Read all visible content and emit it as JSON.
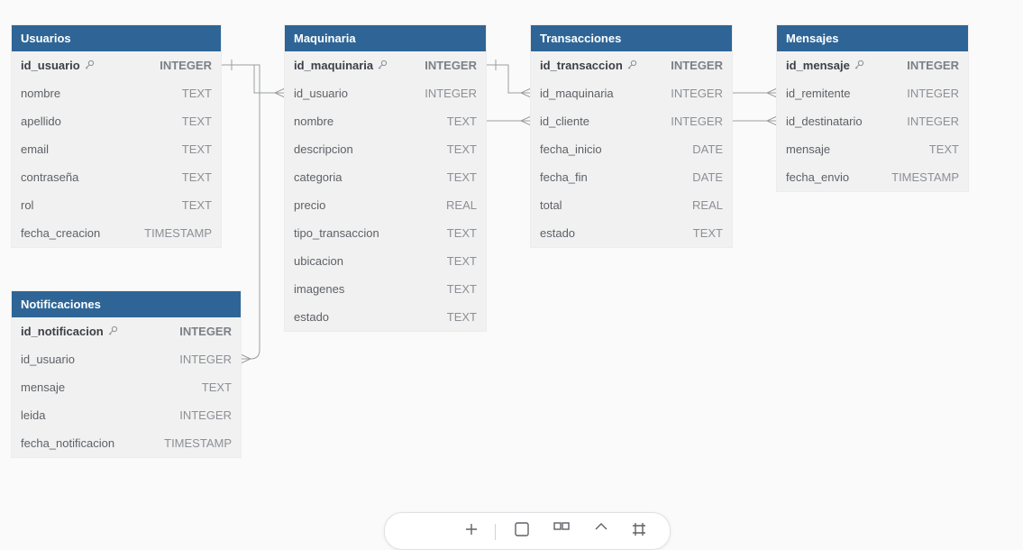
{
  "tables": {
    "usuarios": {
      "title": "Usuarios",
      "columns": [
        {
          "name": "id_usuario",
          "type": "INTEGER"
        },
        {
          "name": "nombre",
          "type": "TEXT"
        },
        {
          "name": "apellido",
          "type": "TEXT"
        },
        {
          "name": "email",
          "type": "TEXT"
        },
        {
          "name": "contraseña",
          "type": "TEXT"
        },
        {
          "name": "rol",
          "type": "TEXT"
        },
        {
          "name": "fecha_creacion",
          "type": "TIMESTAMP"
        }
      ]
    },
    "maquinaria": {
      "title": "Maquinaria",
      "columns": [
        {
          "name": "id_maquinaria",
          "type": "INTEGER"
        },
        {
          "name": "id_usuario",
          "type": "INTEGER"
        },
        {
          "name": "nombre",
          "type": "TEXT"
        },
        {
          "name": "descripcion",
          "type": "TEXT"
        },
        {
          "name": "categoria",
          "type": "TEXT"
        },
        {
          "name": "precio",
          "type": "REAL"
        },
        {
          "name": "tipo_transaccion",
          "type": "TEXT"
        },
        {
          "name": "ubicacion",
          "type": "TEXT"
        },
        {
          "name": "imagenes",
          "type": "TEXT"
        },
        {
          "name": "estado",
          "type": "TEXT"
        }
      ]
    },
    "transacciones": {
      "title": "Transacciones",
      "columns": [
        {
          "name": "id_transaccion",
          "type": "INTEGER"
        },
        {
          "name": "id_maquinaria",
          "type": "INTEGER"
        },
        {
          "name": "id_cliente",
          "type": "INTEGER"
        },
        {
          "name": "fecha_inicio",
          "type": "DATE"
        },
        {
          "name": "fecha_fin",
          "type": "DATE"
        },
        {
          "name": "total",
          "type": "REAL"
        },
        {
          "name": "estado",
          "type": "TEXT"
        }
      ]
    },
    "mensajes": {
      "title": "Mensajes",
      "columns": [
        {
          "name": "id_mensaje",
          "type": "INTEGER"
        },
        {
          "name": "id_remitente",
          "type": "INTEGER"
        },
        {
          "name": "id_destinatario",
          "type": "INTEGER"
        },
        {
          "name": "mensaje",
          "type": "TEXT"
        },
        {
          "name": "fecha_envio",
          "type": "TIMESTAMP"
        }
      ]
    },
    "notificaciones": {
      "title": "Notificaciones",
      "columns": [
        {
          "name": "id_notificacion",
          "type": "INTEGER"
        },
        {
          "name": "id_usuario",
          "type": "INTEGER"
        },
        {
          "name": "mensaje",
          "type": "TEXT"
        },
        {
          "name": "leida",
          "type": "INTEGER"
        },
        {
          "name": "fecha_notificacion",
          "type": "TIMESTAMP"
        }
      ]
    }
  },
  "toolbar": {
    "icons": [
      "add-icon",
      "note-icon",
      "group-icon",
      "tag-icon",
      "frame-icon"
    ]
  },
  "colors": {
    "header": "#2e6596",
    "body": "#f1f1f1",
    "connector": "#9a9da1"
  }
}
